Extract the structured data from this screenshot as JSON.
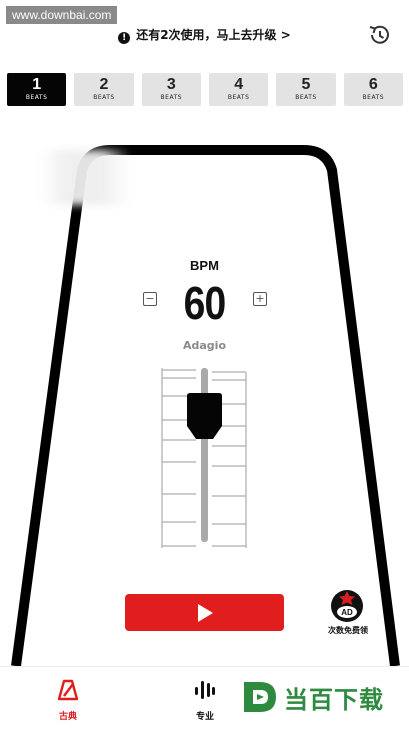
{
  "watermark": "www.downbai.com",
  "notice": {
    "text": "还有2次使用，马上去升级 >",
    "icon": "info-icon"
  },
  "header": {
    "history_icon": "history-icon"
  },
  "beats": [
    {
      "num": "1",
      "label": "BEATS",
      "active": true
    },
    {
      "num": "2",
      "label": "BEATS",
      "active": false
    },
    {
      "num": "3",
      "label": "BEATS",
      "active": false
    },
    {
      "num": "4",
      "label": "BEATS",
      "active": false
    },
    {
      "num": "5",
      "label": "BEATS",
      "active": false
    },
    {
      "num": "6",
      "label": "BEATS",
      "active": false
    }
  ],
  "metronome": {
    "bpm_label": "BPM",
    "bpm_value": "60",
    "decrease": "−",
    "increase": "+",
    "tempo_name": "Adagio"
  },
  "play": {
    "icon": "play-icon"
  },
  "ad": {
    "badge": "AD",
    "caption": "次数免费领"
  },
  "nav": [
    {
      "label": "古典",
      "icon": "metronome-icon",
      "active": true
    },
    {
      "label": "专业",
      "icon": "waveform-icon",
      "active": false
    }
  ],
  "brand": {
    "text": "当百下载"
  },
  "colors": {
    "accent": "#e11e1e",
    "active_tab": "#050505",
    "brand": "#2d8a3e"
  }
}
